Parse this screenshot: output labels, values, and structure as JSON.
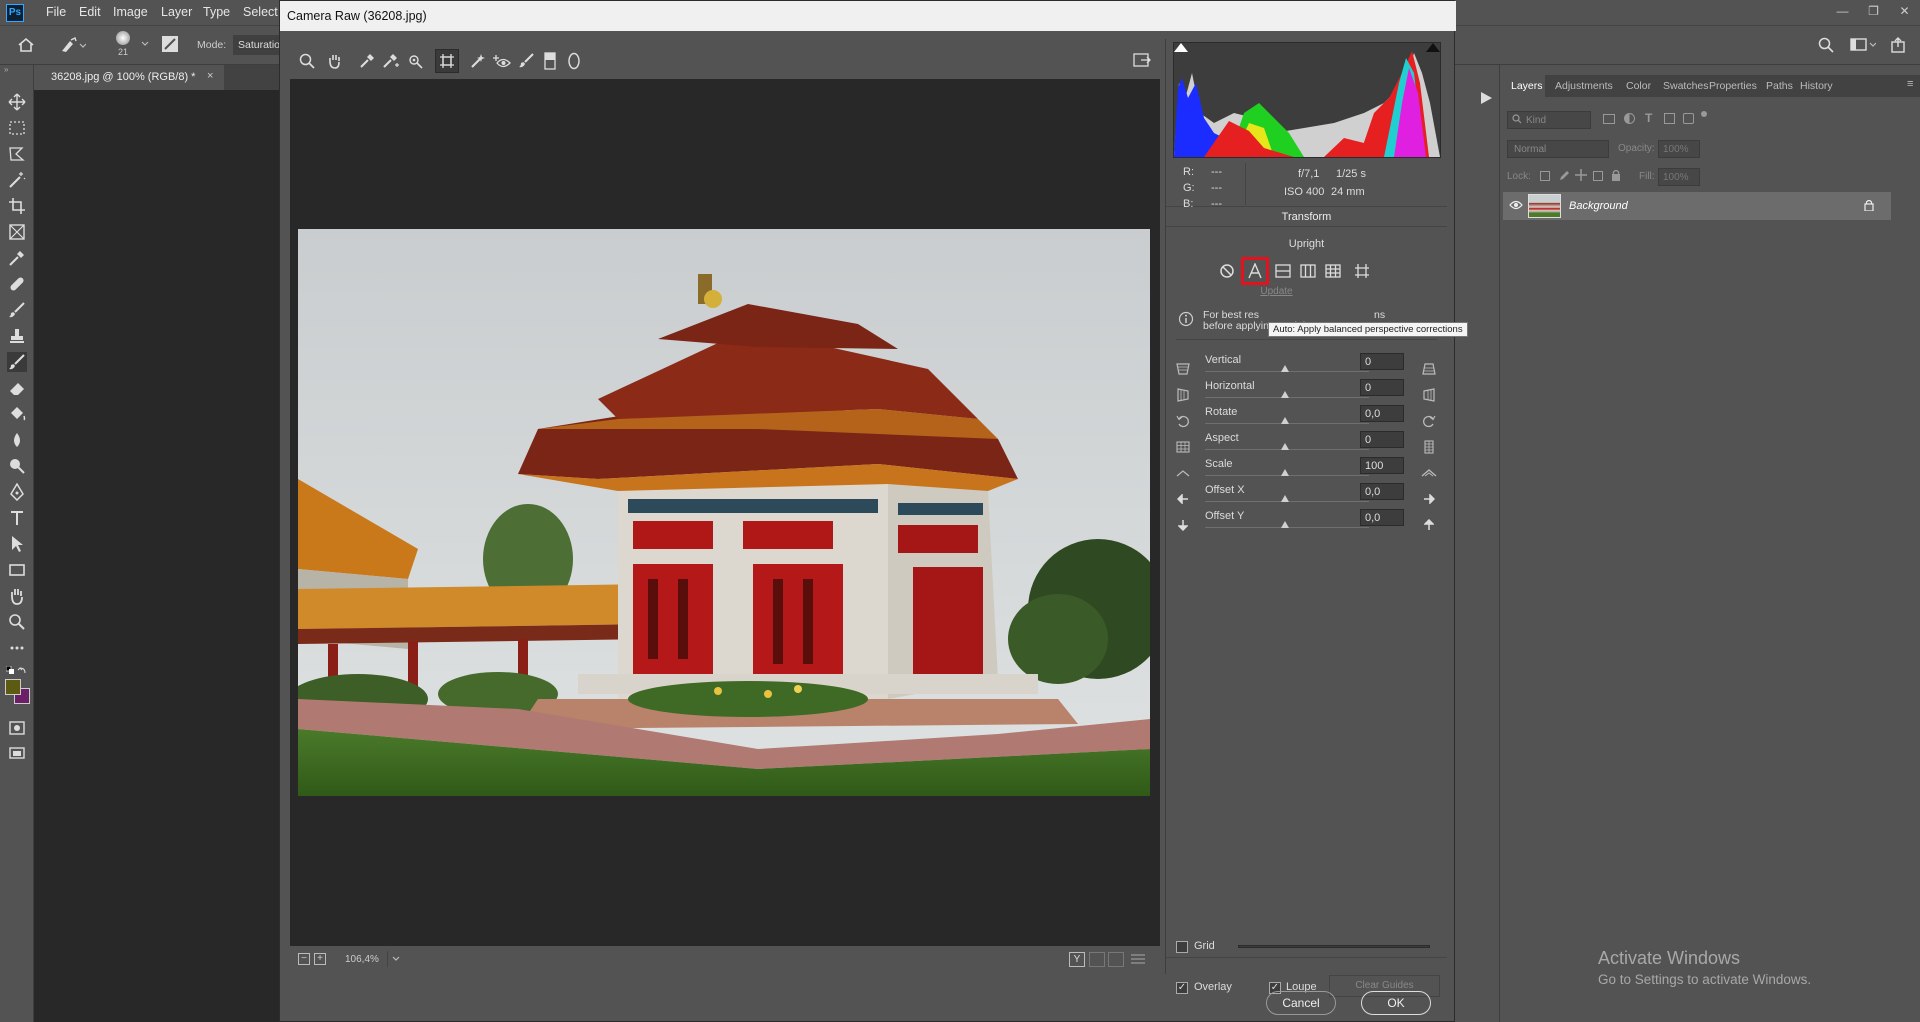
{
  "photoshop": {
    "logo": "Ps",
    "menu": [
      "File",
      "Edit",
      "Image",
      "Layer",
      "Type",
      "Select"
    ],
    "options": {
      "brush_size": "21",
      "mode_label": "Mode:",
      "mode_value": "Saturatio"
    },
    "document_tab": "36208.jpg @ 100% (RGB/8) *",
    "document_tab_close": "×",
    "window_controls": [
      "—",
      "❐",
      "✕"
    ]
  },
  "dialog": {
    "title": "Camera Raw (36208.jpg)",
    "camera_info": {
      "r_label": "R:",
      "g_label": "G:",
      "b_label": "B:",
      "r_val": "---",
      "g_val": "---",
      "b_val": "---",
      "aperture": "f/7,1",
      "shutter": "1/25 s",
      "iso": "ISO 400",
      "focal": "24 mm"
    },
    "panel_title": "Transform",
    "upright_label": "Upright",
    "update_label": "Update",
    "tooltip": "Auto: Apply balanced perspective corrections",
    "info_text_1": "For best res",
    "info_text_1b": "ns",
    "info_text_2": "before applying Upright.",
    "sliders": [
      {
        "label": "Vertical",
        "value": "0"
      },
      {
        "label": "Horizontal",
        "value": "0"
      },
      {
        "label": "Rotate",
        "value": "0,0"
      },
      {
        "label": "Aspect",
        "value": "0"
      },
      {
        "label": "Scale",
        "value": "100"
      },
      {
        "label": "Offset X",
        "value": "0,0"
      },
      {
        "label": "Offset Y",
        "value": "0,0"
      }
    ],
    "grid_label": "Grid",
    "overlay_label": "Overlay",
    "loupe_label": "Loupe",
    "clear_guides_label": "Clear Guides",
    "zoom_value": "106,4%",
    "cancel_label": "Cancel",
    "ok_label": "OK",
    "status_y_label": "Y"
  },
  "layers_panel": {
    "tabs": [
      "Layers",
      "Adjustments",
      "Color",
      "Swatches",
      "Properties",
      "Paths",
      "History"
    ],
    "kind_placeholder": "Kind",
    "blend_mode": "Normal",
    "opacity_label": "Opacity:",
    "opacity_value": "100%",
    "lock_label": "Lock:",
    "fill_label": "Fill:",
    "fill_value": "100%",
    "layer_name": "Background"
  },
  "watermark": {
    "line1": "Activate Windows",
    "line2": "Go to Settings to activate Windows."
  },
  "colors": {
    "accent_red": "#e3121e",
    "foreground_swatch": "#5d5a12",
    "background_swatch": "#6c1e66"
  }
}
